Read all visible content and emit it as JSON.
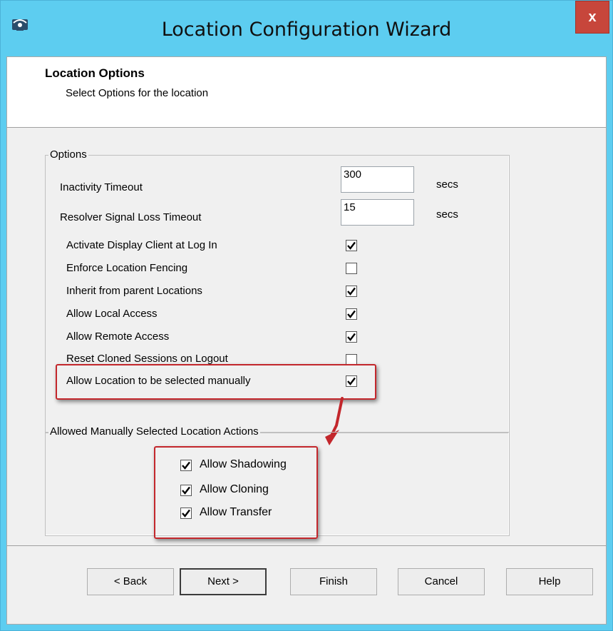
{
  "window": {
    "title": "Location Configuration Wizard",
    "close_label": "x",
    "app_icon": "terminal-server-icon"
  },
  "header": {
    "title": "Location Options",
    "subtitle": "Select Options for the location"
  },
  "options": {
    "legend": "Options",
    "inactivity": {
      "label": "Inactivity Timeout",
      "value": "300",
      "unit": "secs"
    },
    "resolver": {
      "label": "Resolver Signal Loss Timeout",
      "value": "15",
      "unit": "secs"
    },
    "checks": [
      {
        "label": "Activate Display Client at Log In",
        "checked": true
      },
      {
        "label": "Enforce Location Fencing",
        "checked": false
      },
      {
        "label": "Inherit from parent Locations",
        "checked": true
      },
      {
        "label": "Allow Local Access",
        "checked": true
      },
      {
        "label": "Allow Remote Access",
        "checked": true
      },
      {
        "label": "Reset Cloned Sessions on Logout",
        "checked": false
      },
      {
        "label": "Allow Location to be selected manually",
        "checked": true
      }
    ]
  },
  "actions": {
    "legend": "Allowed Manually Selected Location Actions",
    "items": [
      {
        "label": "Allow Shadowing",
        "checked": true
      },
      {
        "label": "Allow Cloning",
        "checked": true
      },
      {
        "label": "Allow Transfer",
        "checked": true
      }
    ]
  },
  "buttons": {
    "back": "< Back",
    "next": "Next >",
    "finish": "Finish",
    "cancel": "Cancel",
    "help": "Help"
  },
  "colors": {
    "titlebar": "#5dcdf0",
    "close": "#c7463b",
    "highlight": "#c3272c"
  }
}
